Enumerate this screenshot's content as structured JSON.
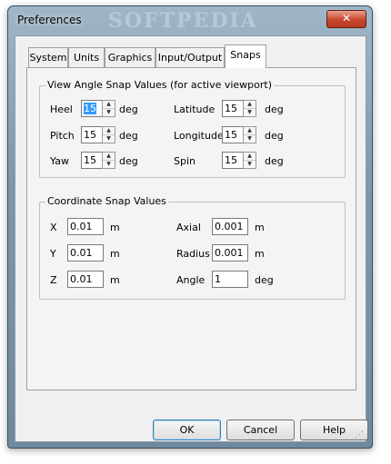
{
  "window": {
    "title": "Preferences",
    "watermark": "SOFTPEDIA",
    "close_glyph": "✕"
  },
  "tabs": [
    {
      "label": "System",
      "active": false
    },
    {
      "label": "Units",
      "active": false
    },
    {
      "label": "Graphics",
      "active": false
    },
    {
      "label": "Input/Output",
      "active": false
    },
    {
      "label": "Snaps",
      "active": true
    }
  ],
  "view_angle": {
    "title": "View Angle Snap Values (for active viewport)",
    "unit": "deg",
    "left": [
      {
        "label": "Heel",
        "value": "15",
        "selected": true
      },
      {
        "label": "Pitch",
        "value": "15",
        "selected": false
      },
      {
        "label": "Yaw",
        "value": "15",
        "selected": false
      }
    ],
    "right": [
      {
        "label": "Latitude",
        "value": "15"
      },
      {
        "label": "Longitude",
        "value": "15"
      },
      {
        "label": "Spin",
        "value": "15"
      }
    ]
  },
  "coordinate": {
    "title": "Coordinate Snap Values",
    "left": [
      {
        "label": "X",
        "value": "0.01",
        "unit": "m"
      },
      {
        "label": "Y",
        "value": "0.01",
        "unit": "m"
      },
      {
        "label": "Z",
        "value": "0.01",
        "unit": "m"
      }
    ],
    "right": [
      {
        "label": "Axial",
        "value": "0.001",
        "unit": "m"
      },
      {
        "label": "Radius",
        "value": "0.001",
        "unit": "m"
      },
      {
        "label": "Angle",
        "value": "1",
        "unit": "deg"
      }
    ]
  },
  "buttons": {
    "ok": "OK",
    "cancel": "Cancel",
    "help": "Help"
  },
  "icons": {
    "spin_up": "▲",
    "spin_down": "▼",
    "resize_grip": "resize-grip-icon"
  },
  "colors": {
    "selection": "#3399ff",
    "close": "#c7472d"
  }
}
